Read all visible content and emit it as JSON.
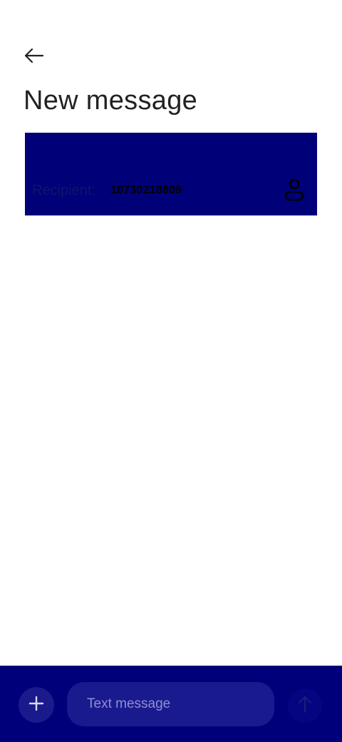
{
  "header": {
    "back_icon": "arrow-left-icon",
    "title": "New message"
  },
  "recipient": {
    "label": "Recipient:",
    "value": "18730218809",
    "contact_icon": "person-icon",
    "card_color": "#000078"
  },
  "compose": {
    "bar_color": "#00007a",
    "attach_icon": "plus-icon",
    "input_placeholder": "Text message",
    "input_value": "",
    "send_icon": "arrow-up-icon"
  }
}
